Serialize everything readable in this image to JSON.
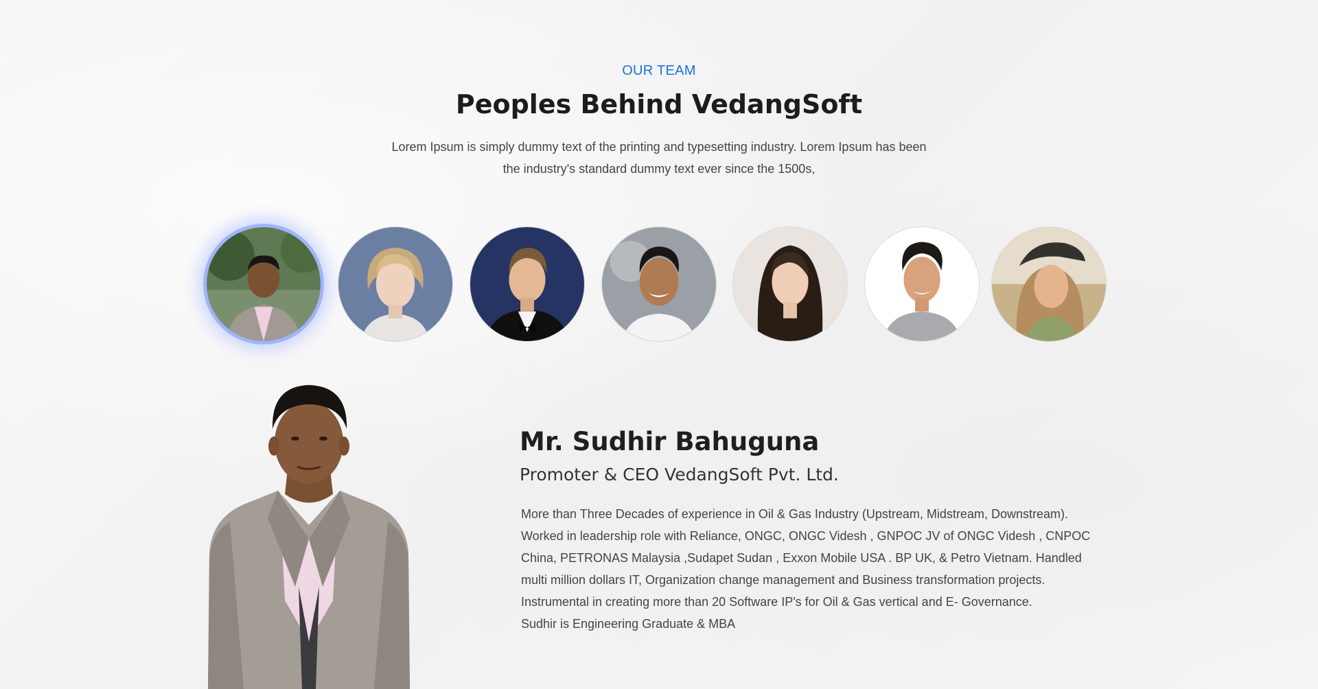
{
  "section": {
    "eyebrow": "OUR TEAM",
    "heading": "Peoples Behind VedangSoft",
    "intro_line1": "Lorem Ipsum is simply dummy text of the printing and typesetting industry. Lorem Ipsum has been",
    "intro_line2": "the industry's standard dummy text ever since the 1500s,"
  },
  "team": {
    "active_index": 0,
    "avatars": [
      {
        "icon": "man-suit-photo",
        "bg": "#5d7a52"
      },
      {
        "icon": "woman-blonde-photo",
        "bg": "#6b7fa3"
      },
      {
        "icon": "man-tuxedo-photo",
        "bg": "#253462"
      },
      {
        "icon": "man-smiling-photo",
        "bg": "#9aa0a6"
      },
      {
        "icon": "woman-brunette-photo",
        "bg": "#e9e4df"
      },
      {
        "icon": "man-grey-tshirt-photo",
        "bg": "#ffffff"
      },
      {
        "icon": "woman-cap-photo",
        "bg": "#c8b28a"
      }
    ]
  },
  "member": {
    "name": "Mr. Sudhir Bahuguna",
    "role": "Promoter & CEO VedangSoft Pvt. Ltd.",
    "bio": [
      "More than Three Decades of experience in Oil & Gas Industry (Upstream, Midstream, Downstream).",
      "Worked in leadership role with Reliance, ONGC, ONGC Videsh , GNPOC JV of ONGC Videsh , CNPOC",
      "China, PETRONAS Malaysia ,Sudapet Sudan , Exxon Mobile USA . BP UK, & Petro Vietnam. Handled",
      "multi million dollars IT, Organization change management and Business transformation projects.",
      "Instrumental in creating more than 20 Software IP's for Oil & Gas vertical and E- Governance.",
      "Sudhir is Engineering Graduate & MBA"
    ]
  },
  "colors": {
    "accent": "#1a73d9",
    "active_ring": "#9fb3ff",
    "heading": "#1c1c1c",
    "body_text": "#444444"
  }
}
